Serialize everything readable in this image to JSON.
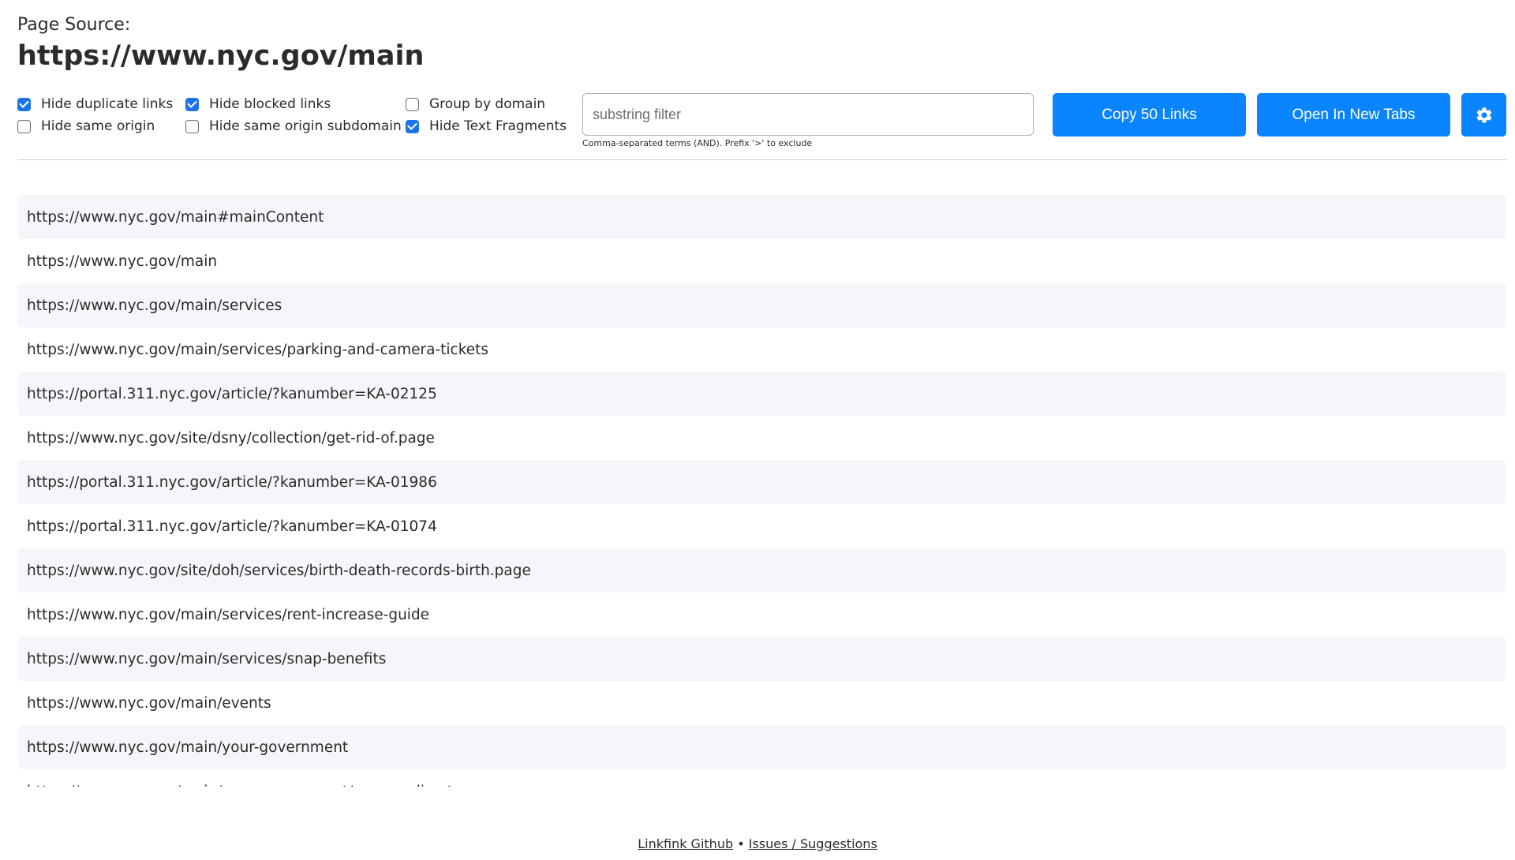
{
  "header": {
    "label": "Page Source:",
    "url": "https://www.nyc.gov/main"
  },
  "options": [
    {
      "label": "Hide duplicate links",
      "checked": true
    },
    {
      "label": "Hide same origin",
      "checked": false
    },
    {
      "label": "Hide blocked links",
      "checked": true
    },
    {
      "label": "Hide same origin subdomain",
      "checked": false
    },
    {
      "label": "Group by domain",
      "checked": false
    },
    {
      "label": "Hide Text Fragments",
      "checked": true
    }
  ],
  "filter": {
    "placeholder": "substring filter",
    "value": "",
    "hint": "Comma-separated terms (AND). Prefix '>' to exclude"
  },
  "buttons": {
    "copy": "Copy 50 Links",
    "open": "Open In New Tabs",
    "settings_icon": "gear-icon"
  },
  "links": [
    "https://www.nyc.gov/main#mainContent",
    "https://www.nyc.gov/main",
    "https://www.nyc.gov/main/services",
    "https://www.nyc.gov/main/services/parking-and-camera-tickets",
    "https://portal.311.nyc.gov/article/?kanumber=KA-02125",
    "https://www.nyc.gov/site/dsny/collection/get-rid-of.page",
    "https://portal.311.nyc.gov/article/?kanumber=KA-01986",
    "https://portal.311.nyc.gov/article/?kanumber=KA-01074",
    "https://www.nyc.gov/site/doh/services/birth-death-records-birth.page",
    "https://www.nyc.gov/main/services/rent-increase-guide",
    "https://www.nyc.gov/main/services/snap-benefits",
    "https://www.nyc.gov/main/events",
    "https://www.nyc.gov/main/your-government",
    "https://www.nyc.gov/main/your-government/agency-directory"
  ],
  "footer": {
    "github": "Linkfink Github",
    "separator": "•",
    "issues": "Issues / Suggestions"
  },
  "colors": {
    "accent": "#0a84ff",
    "row_alt": "#f4f6fa"
  }
}
